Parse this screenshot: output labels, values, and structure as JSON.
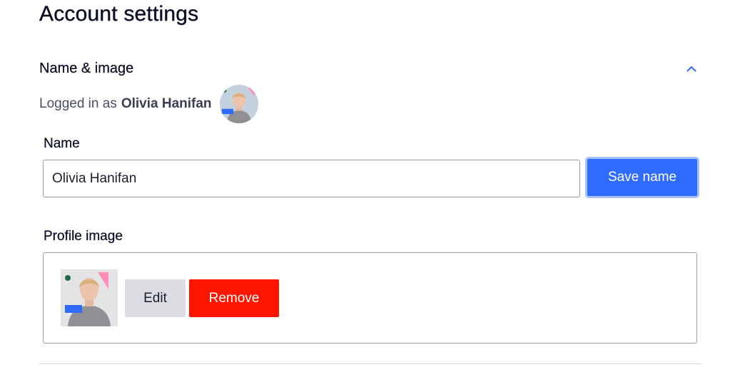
{
  "page": {
    "title": "Account settings"
  },
  "section": {
    "title": "Name & image",
    "collapse_icon": "chevron-up-icon"
  },
  "logged_in": {
    "prefix": "Logged in as",
    "user_name": "Olivia Hanifan"
  },
  "name_field": {
    "label": "Name",
    "value": "Olivia Hanifan",
    "save_label": "Save name"
  },
  "profile_image": {
    "label": "Profile image",
    "edit_label": "Edit",
    "remove_label": "Remove"
  },
  "colors": {
    "primary": "#2f6bff",
    "danger": "#ff1500",
    "secondary": "#dcdde2"
  }
}
